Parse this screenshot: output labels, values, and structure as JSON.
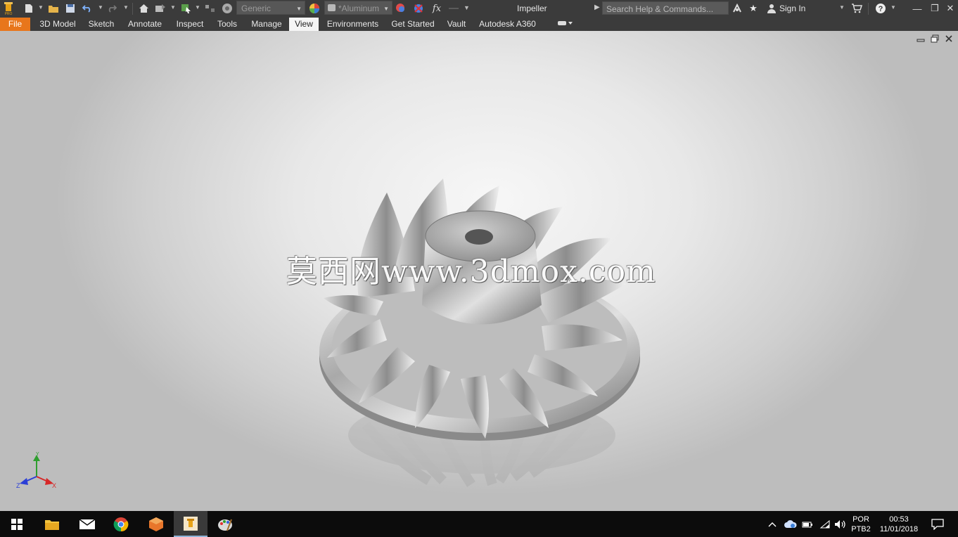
{
  "window": {
    "document_title": "Impeller",
    "minimize_glyph": "—",
    "restore_glyph": "❐",
    "close_glyph": "✕"
  },
  "quick_access": {
    "appearance_style": "Generic",
    "material": "*Aluminum",
    "formula_glyph": "fx"
  },
  "search": {
    "placeholder": "Search Help & Commands..."
  },
  "account": {
    "sign_in_label": "Sign In"
  },
  "ribbon_tabs": [
    {
      "label": "File"
    },
    {
      "label": "3D Model"
    },
    {
      "label": "Sketch"
    },
    {
      "label": "Annotate"
    },
    {
      "label": "Inspect"
    },
    {
      "label": "Tools"
    },
    {
      "label": "Manage"
    },
    {
      "label": "View",
      "active": true
    },
    {
      "label": "Environments"
    },
    {
      "label": "Get Started"
    },
    {
      "label": "Vault"
    },
    {
      "label": "Autodesk A360"
    }
  ],
  "viewport": {
    "watermark": "莫西网www.3dmox.com",
    "triad": {
      "x_label": "X",
      "y_label": "Y",
      "z_label": "Z"
    }
  },
  "taskbar": {
    "language_top": "POR",
    "language_bottom": "PTB2",
    "time": "00:53",
    "date": "11/01/2018"
  },
  "colors": {
    "file_tab": "#e8761b",
    "chrome_dark": "#3b3b3b",
    "taskbar": "#0c0c0c",
    "axis_x": "#d62828",
    "axis_y": "#2e9e2e",
    "axis_z": "#2b3fd6"
  }
}
